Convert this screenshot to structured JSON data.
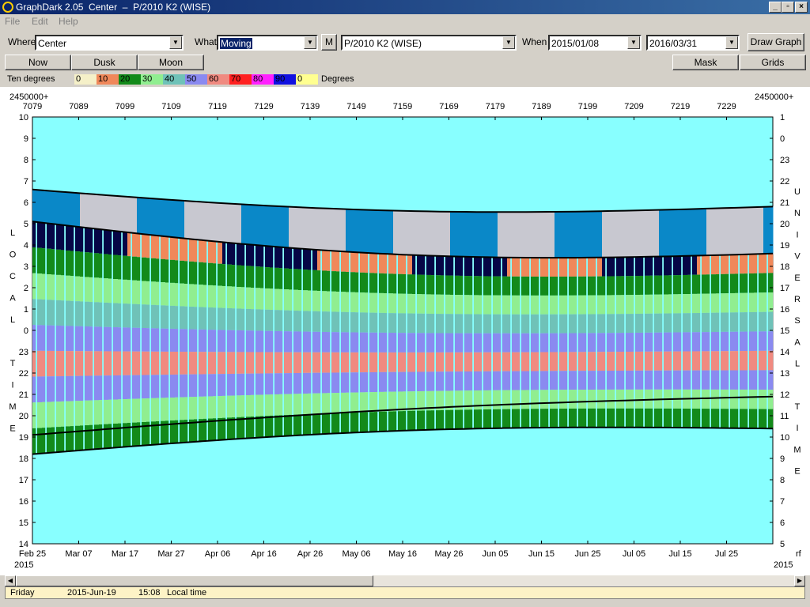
{
  "window": {
    "title": "GraphDark 2.05  Center  –  P/2010 K2 (WISE)"
  },
  "menu": [
    "File",
    "Edit",
    "Help"
  ],
  "toolbar": {
    "where_label": "Where",
    "where_value": "Center",
    "what_label": "What",
    "what_value": "Moving",
    "m_button": "M",
    "object_value": "P/2010 K2 (WISE)",
    "when_label": "When",
    "start_date": "2015/01/08",
    "end_date": "2016/03/31",
    "draw_button": "Draw Graph"
  },
  "buttons": {
    "now": "Now",
    "dusk": "Dusk",
    "moon": "Moon",
    "mask": "Mask",
    "grids": "Grids"
  },
  "legend": {
    "title": "Ten degrees",
    "unit": "Degrees",
    "items": [
      {
        "label": "0",
        "color": "#f5f0c8"
      },
      {
        "label": "10",
        "color": "#f0885a"
      },
      {
        "label": "20",
        "color": "#138a1a"
      },
      {
        "label": "30",
        "color": "#90ee90"
      },
      {
        "label": "40",
        "color": "#6fc2b8"
      },
      {
        "label": "50",
        "color": "#8a8af0"
      },
      {
        "label": "60",
        "color": "#f08a80"
      },
      {
        "label": "70",
        "color": "#ff2020"
      },
      {
        "label": "80",
        "color": "#ff20ff"
      },
      {
        "label": "90",
        "color": "#1010e0"
      },
      {
        "label": "0",
        "color": "#ffff90"
      }
    ]
  },
  "chart_data": {
    "type": "heatmap",
    "jd_prefix_left": "2450000+",
    "jd_prefix_right": "2450000+",
    "jd_ticks": [
      "7079",
      "7089",
      "7099",
      "7109",
      "7119",
      "7129",
      "7139",
      "7149",
      "7159",
      "7169",
      "7179",
      "7189",
      "7199",
      "7209",
      "7219",
      "7229"
    ],
    "date_ticks": [
      "Feb 25",
      "Mar 07",
      "Mar 17",
      "Mar 27",
      "Apr 06",
      "Apr 16",
      "Apr 26",
      "May 06",
      "May 16",
      "May 26",
      "Jun 05",
      "Jun 15",
      "Jun 25",
      "Jul 05",
      "Jul 15",
      "Jul 25"
    ],
    "year_left": "2015",
    "year_right": "2015",
    "right_corner_label": "rf",
    "local_time_ticks": [
      "10",
      "9",
      "8",
      "7",
      "6",
      "5",
      "4",
      "3",
      "2",
      "1",
      "0",
      "23",
      "22",
      "21",
      "20",
      "19",
      "18",
      "17",
      "16",
      "15",
      "14"
    ],
    "universal_time_ticks": [
      "1",
      "0",
      "23",
      "22",
      "21",
      "20",
      "19",
      "18",
      "17",
      "16",
      "15",
      "14",
      "13",
      "12",
      "11",
      "10",
      "9",
      "8",
      "7",
      "6",
      "5"
    ],
    "left_axis_letters": [
      "L",
      "O",
      "C",
      "A",
      "L",
      "",
      "T",
      "I",
      "M",
      "E"
    ],
    "right_axis_letters": [
      "U",
      "N",
      "I",
      "V",
      "E",
      "R",
      "S",
      "A",
      "L",
      "",
      "T",
      "I",
      "M",
      "E"
    ],
    "background_color": "#88ffff",
    "night_color": "#060646",
    "twilight_color": "#0a88c8",
    "moon_color": "#c8c8d0"
  },
  "status": {
    "day": "Friday",
    "date": "2015-Jun-19",
    "time": "15:08",
    "mode": "Local time"
  }
}
